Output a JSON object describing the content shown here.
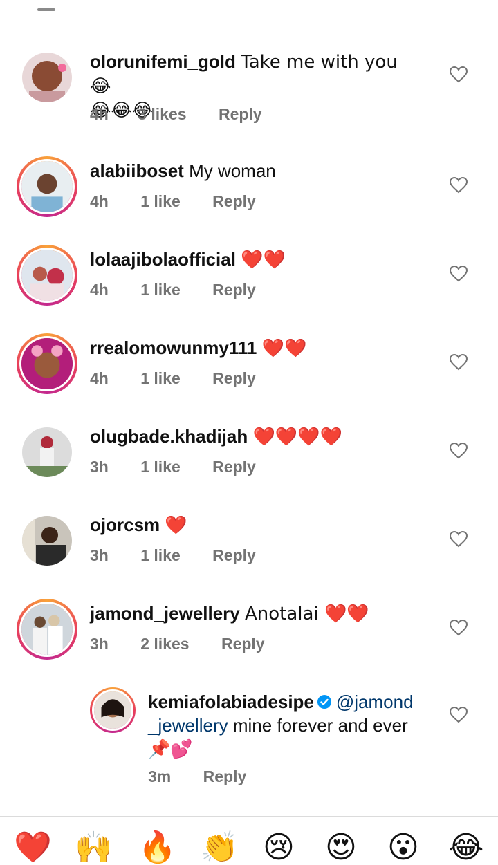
{
  "comments": [
    {
      "username": "olorunifemi_gold",
      "text": "Take me with you 😂",
      "text2": "😂😂😂",
      "time": "4h",
      "likes": "3 likes",
      "reply": "Reply",
      "avatar_icon": "user-avatar"
    },
    {
      "username": "alabiiboset",
      "text": "My woman",
      "time": "4h",
      "likes": "1 like",
      "reply": "Reply",
      "avatar_icon": "user-avatar"
    },
    {
      "username": "lolaajibolaofficial",
      "text": "❤️❤️",
      "time": "4h",
      "likes": "1 like",
      "reply": "Reply",
      "avatar_icon": "user-avatar"
    },
    {
      "username": "rrealomowunmy111",
      "text": "❤️❤️",
      "time": "4h",
      "likes": "1 like",
      "reply": "Reply",
      "avatar_icon": "user-avatar"
    },
    {
      "username": "olugbade.khadijah",
      "text": "❤️❤️❤️❤️",
      "time": "3h",
      "likes": "1 like",
      "reply": "Reply",
      "avatar_icon": "user-avatar"
    },
    {
      "username": "ojorcsm",
      "text": "❤️",
      "time": "3h",
      "likes": "1 like",
      "reply": "Reply",
      "avatar_icon": "user-avatar"
    },
    {
      "username": "jamond_jewellery",
      "text": "Anotalai ❤️❤️",
      "time": "3h",
      "likes": "2 likes",
      "reply": "Reply",
      "avatar_icon": "user-avatar"
    }
  ],
  "reply": {
    "username": "kemiafolabiadesipe",
    "mention_line1": "@jamond",
    "mention_line2": "_jewellery",
    "text": "mine forever and ever",
    "text3": "📌💕",
    "time": "3m",
    "reply": "Reply",
    "verified_icon": "verified-badge-icon"
  },
  "emoji_bar": [
    "❤️",
    "🙌",
    "🔥",
    "👏",
    "😢",
    "😍",
    "😮",
    "😂"
  ],
  "colors": {
    "accent": "#0095f6",
    "mention": "#00376b",
    "meta": "#737373"
  }
}
